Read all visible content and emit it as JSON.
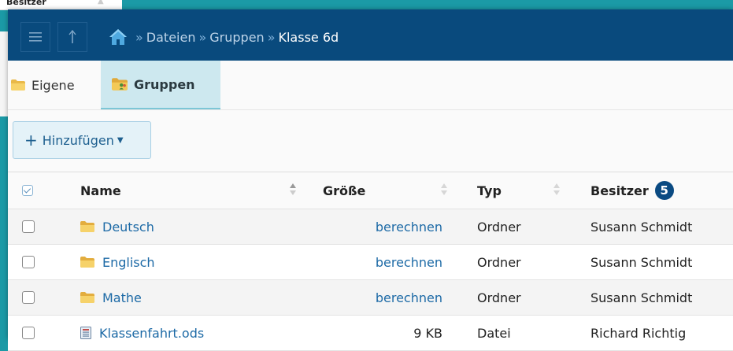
{
  "background": {
    "owner_header_fragment": "Besitzer"
  },
  "nav": {
    "menu_icon": "hamburger-menu-icon",
    "up_icon": "up-arrow-icon",
    "home_icon": "home-icon",
    "breadcrumb": {
      "separator": "»",
      "items": [
        "Dateien",
        "Gruppen"
      ],
      "current": "Klasse 6d"
    }
  },
  "tabs": [
    {
      "label": "Eigene",
      "active": false
    },
    {
      "label": "Gruppen",
      "active": true
    }
  ],
  "toolbar": {
    "add_label": "Hinzufügen",
    "add_plus": "+"
  },
  "table": {
    "columns": {
      "name": "Name",
      "size": "Größe",
      "type": "Typ",
      "owner": "Besitzer",
      "owner_badge": "5"
    },
    "rows": [
      {
        "name": "Deutsch",
        "icon": "folder-icon",
        "size": "berechnen",
        "size_is_link": true,
        "type": "Ordner",
        "owner": "Susann Schmidt"
      },
      {
        "name": "Englisch",
        "icon": "folder-icon",
        "size": "berechnen",
        "size_is_link": true,
        "type": "Ordner",
        "owner": "Susann Schmidt"
      },
      {
        "name": "Mathe",
        "icon": "folder-icon",
        "size": "berechnen",
        "size_is_link": true,
        "type": "Ordner",
        "owner": "Susann Schmidt"
      },
      {
        "name": "Klassenfahrt.ods",
        "icon": "spreadsheet-file-icon",
        "size": "9 KB",
        "size_is_link": false,
        "type": "Datei",
        "owner": "Richard Richtig"
      }
    ]
  },
  "colors": {
    "navbar": "#094a7d",
    "accent_link": "#1d6aa6",
    "active_tab": "#cde8ef",
    "badge": "#0a4a82",
    "backdrop": "#1b9aa6"
  }
}
